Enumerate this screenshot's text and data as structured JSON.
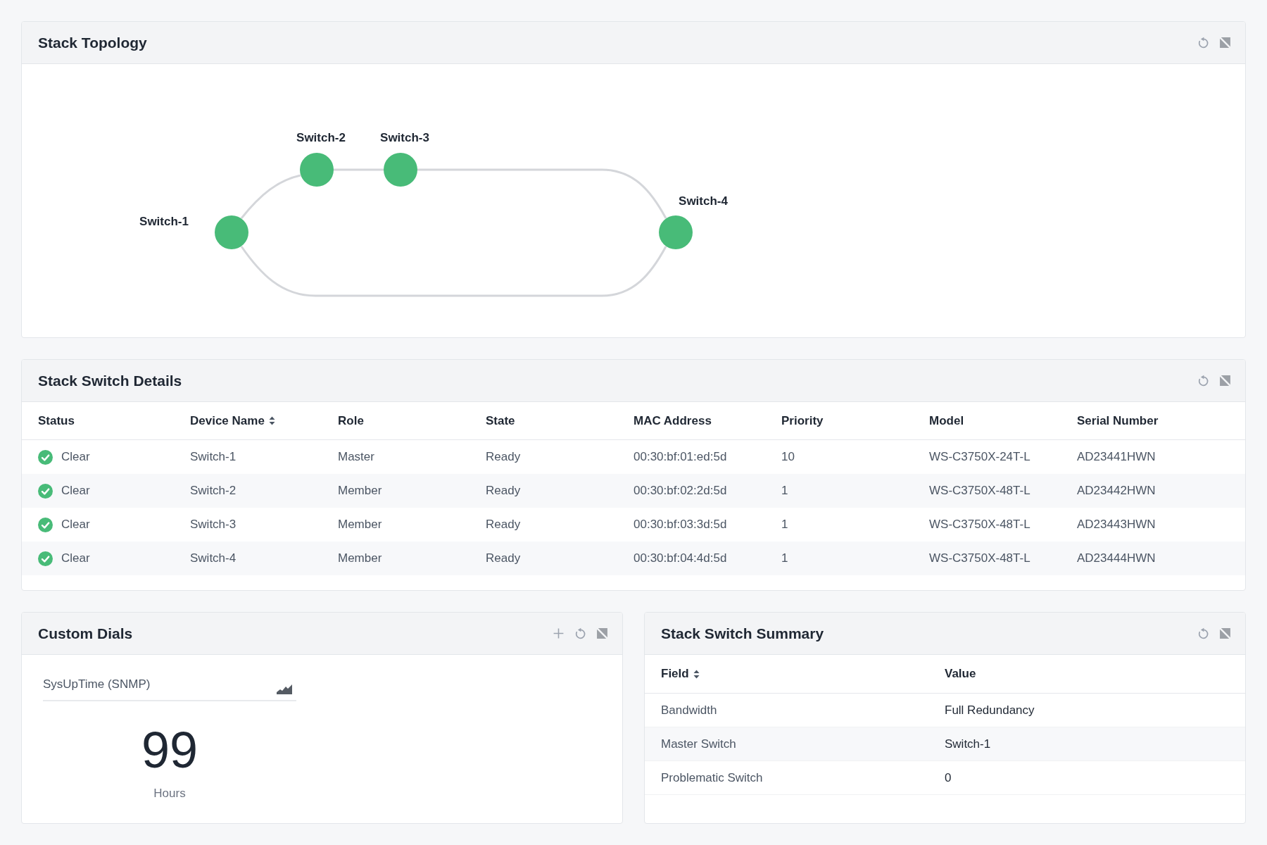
{
  "topology": {
    "title": "Stack Topology",
    "actions": [
      {
        "kind": "refresh"
      },
      {
        "kind": "expand"
      }
    ],
    "nodes": [
      {
        "label": "Switch-1"
      },
      {
        "label": "Switch-2"
      },
      {
        "label": "Switch-3"
      },
      {
        "label": "Switch-4"
      }
    ],
    "ring": true
  },
  "details": {
    "title": "Stack Switch Details",
    "actions": [
      {
        "kind": "refresh"
      },
      {
        "kind": "expand"
      }
    ],
    "columns": [
      {
        "label": "Status",
        "sortable": false
      },
      {
        "label": "Device Name",
        "sortable": true
      },
      {
        "label": "Role",
        "sortable": false
      },
      {
        "label": "State",
        "sortable": false
      },
      {
        "label": "MAC Address",
        "sortable": false
      },
      {
        "label": "Priority",
        "sortable": false
      },
      {
        "label": "Model",
        "sortable": false
      },
      {
        "label": "Serial Number",
        "sortable": false
      }
    ],
    "rows": [
      {
        "kind": "ok",
        "cells": [
          "Clear",
          "Switch-1",
          "Master",
          "Ready",
          "00:30:bf:01:ed:5d",
          "10",
          "WS-C3750X-24T-L",
          "AD23441HWN"
        ]
      },
      {
        "kind": "ok",
        "cells": [
          "Clear",
          "Switch-2",
          "Member",
          "Ready",
          "00:30:bf:02:2d:5d",
          "1",
          "WS-C3750X-48T-L",
          "AD23442HWN"
        ]
      },
      {
        "kind": "ok",
        "cells": [
          "Clear",
          "Switch-3",
          "Member",
          "Ready",
          "00:30:bf:03:3d:5d",
          "1",
          "WS-C3750X-48T-L",
          "AD23443HWN"
        ]
      },
      {
        "kind": "ok",
        "cells": [
          "Clear",
          "Switch-4",
          "Member",
          "Ready",
          "00:30:bf:04:4d:5d",
          "1",
          "WS-C3750X-48T-L",
          "AD23444HWN"
        ]
      }
    ]
  },
  "custom_dials": {
    "title": "Custom Dials",
    "actions": [
      {
        "kind": "add"
      },
      {
        "kind": "refresh"
      },
      {
        "kind": "expand"
      }
    ],
    "dials": [
      {
        "name": "SysUpTime (SNMP)",
        "value": "99",
        "unit": "Hours"
      }
    ]
  },
  "summary": {
    "title": "Stack Switch Summary",
    "actions": [
      {
        "kind": "refresh"
      },
      {
        "kind": "expand"
      }
    ],
    "columns": [
      {
        "label": "Field",
        "sortable": true
      },
      {
        "label": "Value",
        "sortable": false
      }
    ],
    "rows": [
      {
        "cells": [
          "Bandwidth",
          "Full Redundancy"
        ]
      },
      {
        "cells": [
          "Master Switch",
          "Switch-1"
        ]
      },
      {
        "cells": [
          "Problematic Switch",
          "0"
        ]
      }
    ]
  }
}
